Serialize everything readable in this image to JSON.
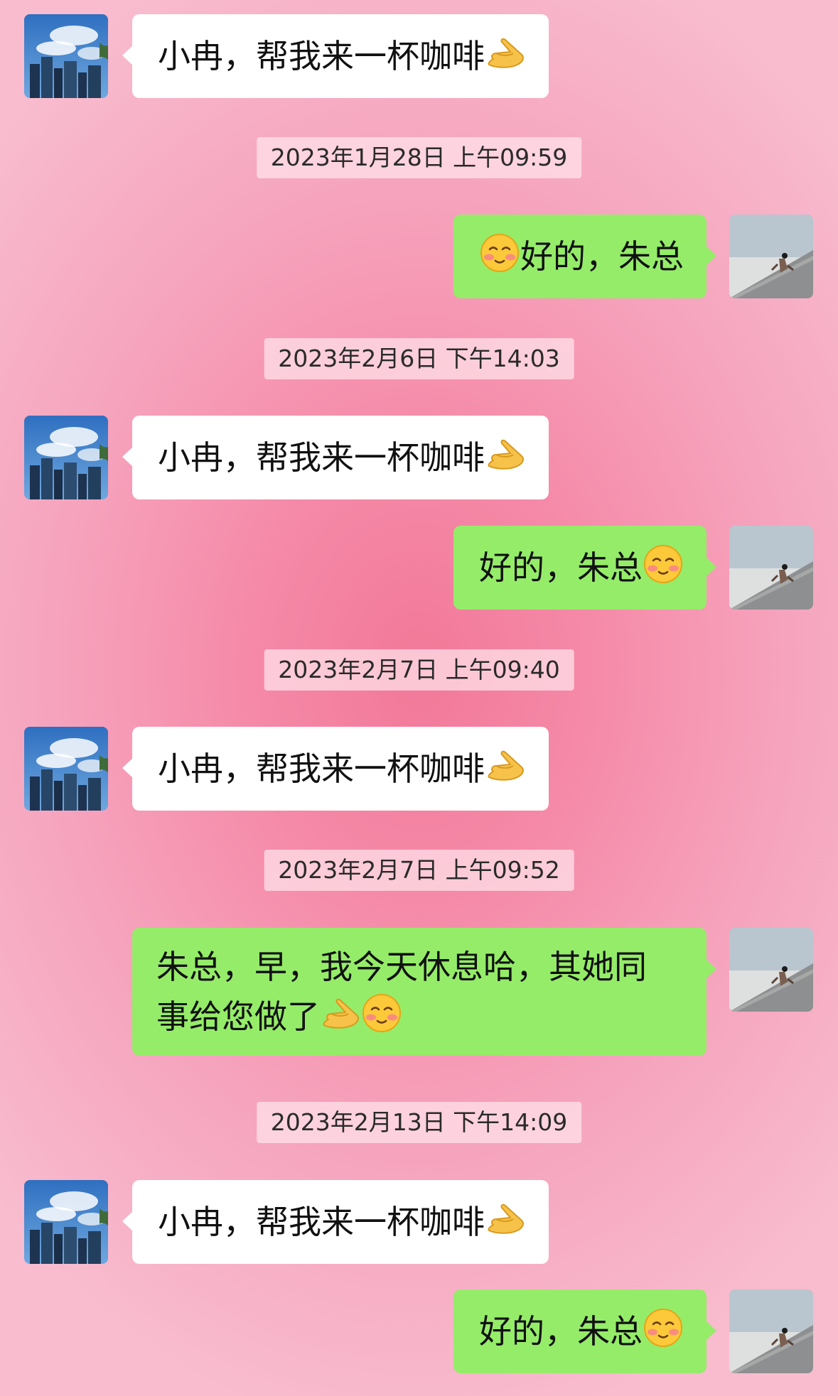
{
  "messages": [
    {
      "text": "小冉，帮我来一杯咖啡"
    },
    {
      "text": "好的，朱总"
    },
    {
      "text": "小冉，帮我来一杯咖啡"
    },
    {
      "text": "好的，朱总"
    },
    {
      "text": "小冉，帮我来一杯咖啡"
    },
    {
      "line1": "朱总，早，我今天休息哈，其她同",
      "line2": "事给您做了"
    },
    {
      "text": "小冉，帮我来一杯咖啡"
    },
    {
      "text": "好的，朱总"
    }
  ],
  "timestamps": [
    "2023年1月28日 上午09:59",
    "2023年2月6日 下午14:03",
    "2023年2月7日 上午09:40",
    "2023年2月7日 上午09:52",
    "2023年2月13日 下午14:09"
  ],
  "colors": {
    "incoming_bubble": "#ffffff",
    "outgoing_bubble": "#95ec69",
    "background": "#f58aa8"
  },
  "icons": {
    "pinched_hand": "pinching-hand-emoji",
    "smiling_face": "smiling-face-emoji",
    "boss_avatar": "city-skyline-avatar",
    "assistant_avatar": "stairs-figure-avatar"
  }
}
